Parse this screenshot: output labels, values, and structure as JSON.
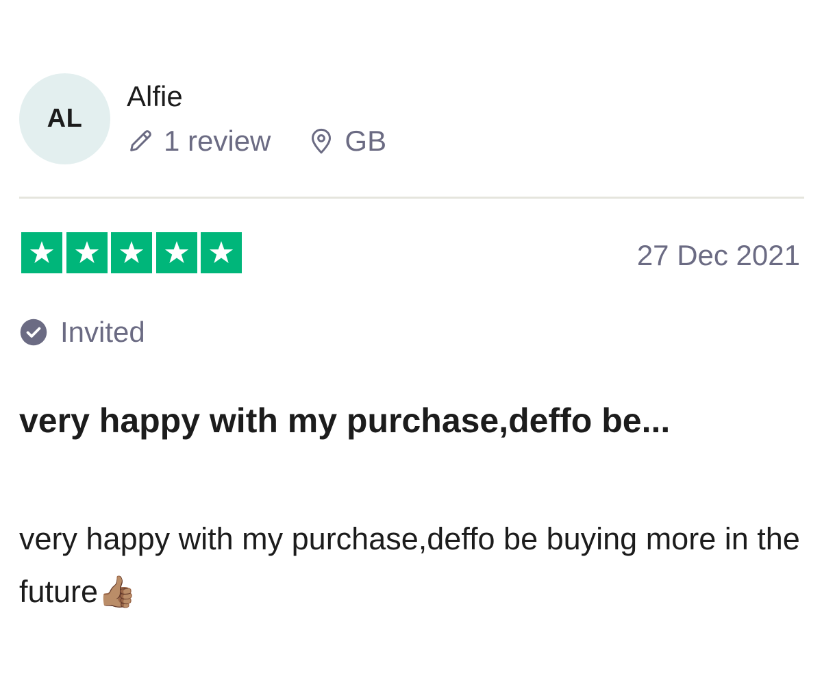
{
  "reviewer": {
    "initials": "AL",
    "name": "Alfie",
    "review_count": "1 review",
    "country": "GB",
    "avatar_bg": "#e3efef"
  },
  "review": {
    "rating": 5,
    "max_rating": 5,
    "star_color": "#00b67a",
    "date": "27 Dec 2021",
    "verification": "Invited",
    "title": "very happy with my purchase,deffo be...",
    "body": "very happy with my purchase,deffo be buying more in the future👍🏽"
  },
  "icons": {
    "review_count": "pencil-icon",
    "country": "location-pin-icon",
    "verification": "check-circle-icon",
    "rating": "star-icon"
  }
}
